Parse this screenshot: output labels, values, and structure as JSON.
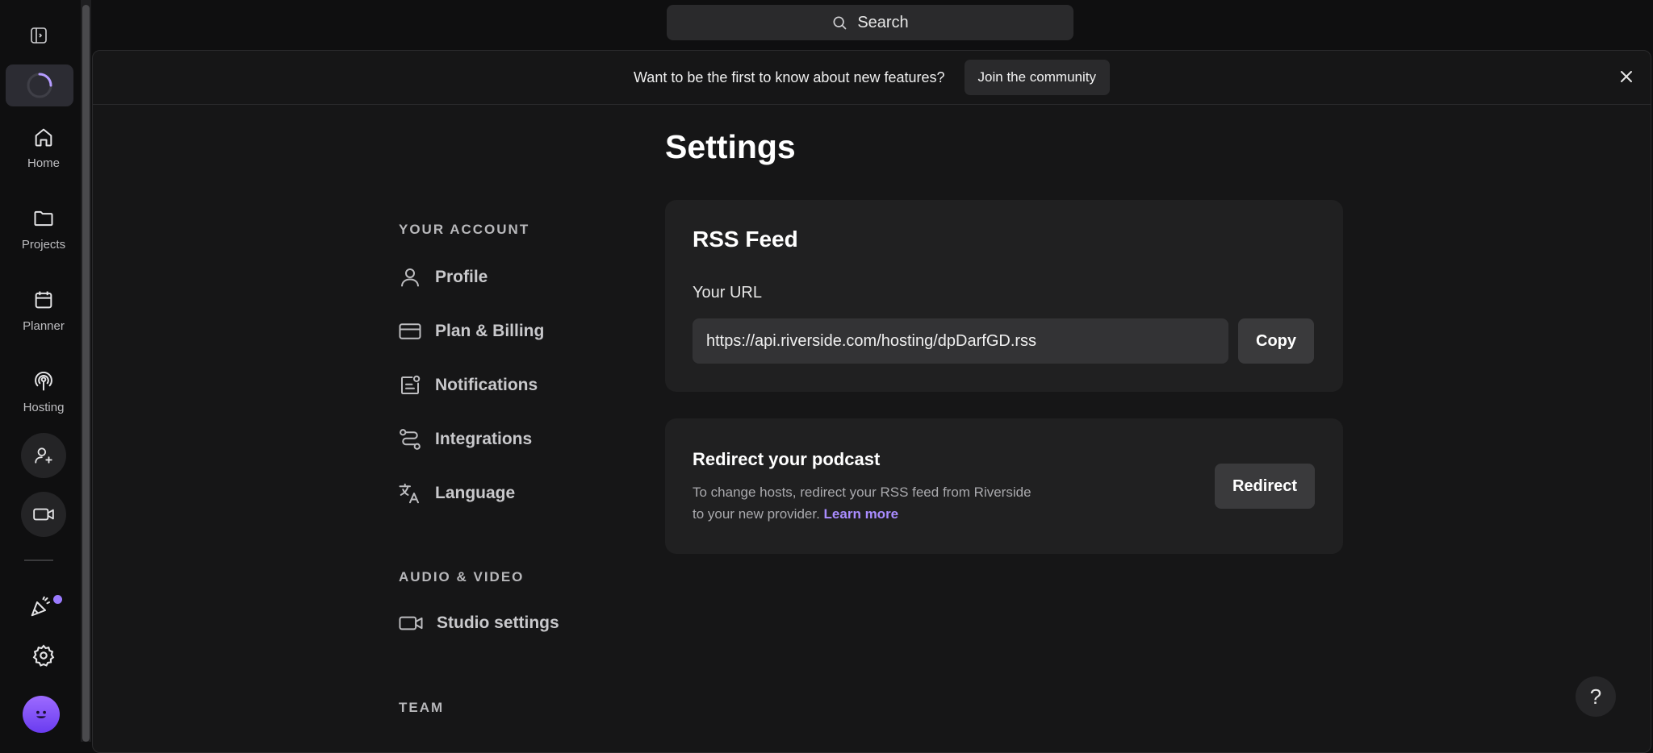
{
  "search": {
    "label": "Search",
    "icon": "search-icon"
  },
  "rail": {
    "items": [
      {
        "label": "Home",
        "icon": "home-icon"
      },
      {
        "label": "Projects",
        "icon": "folder-icon"
      },
      {
        "label": "Planner",
        "icon": "calendar-icon"
      },
      {
        "label": "Hosting",
        "icon": "podcast-icon"
      }
    ],
    "accent": "#9b7bff"
  },
  "banner": {
    "text": "Want to be the first to know about new features?",
    "join_label": "Join the community"
  },
  "page": {
    "title": "Settings"
  },
  "nav": {
    "your_account_heading": "YOUR ACCOUNT",
    "account_items": [
      "Profile",
      "Plan & Billing",
      "Notifications",
      "Integrations",
      "Language"
    ],
    "audio_video_heading": "AUDIO & VIDEO",
    "audio_video_items": [
      "Studio settings"
    ],
    "team_heading": "TEAM"
  },
  "rss": {
    "title": "RSS Feed",
    "url_label": "Your URL",
    "url_value": "https://api.riverside.com/hosting/dpDarfGD.rss",
    "copy_label": "Copy"
  },
  "redirect": {
    "title": "Redirect your podcast",
    "desc_line1": "To change hosts, redirect your RSS feed from Riverside",
    "desc_line2": "to your new provider.",
    "learn_more": "Learn more",
    "button_label": "Redirect"
  },
  "help": {
    "label": "?"
  }
}
